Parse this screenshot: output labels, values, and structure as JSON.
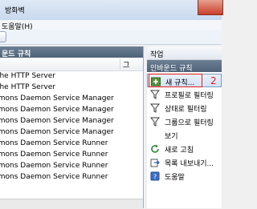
{
  "window": {
    "title": "방화벽"
  },
  "menu": {
    "items": [
      {
        "label": "도움말(H)"
      }
    ]
  },
  "left_pane": {
    "header": "운드 규칙",
    "column_header": "그",
    "rows": [
      "ache HTTP Server",
      "ache HTTP Server",
      "mmons Daemon Service Manager",
      "mmons Daemon Service Manager",
      "mmons Daemon Service Manager",
      "mmons Daemon Service Manager",
      "mmons Daemon Service Runner",
      "mmons Daemon Service Runner",
      "mmons Daemon Service Runner",
      "mmons Daemon Service Runner"
    ]
  },
  "right_pane": {
    "header": "작업",
    "section": "인바운드 규칙",
    "actions": [
      {
        "label": "새 규칙...",
        "icon": "new-rule-icon"
      },
      {
        "label": "프로필로 필터링",
        "icon": "filter-icon"
      },
      {
        "label": "상태로 필터링",
        "icon": "filter-icon"
      },
      {
        "label": "그룹으로 필터링",
        "icon": "filter-icon"
      },
      {
        "label": "보기",
        "icon": "view-icon"
      },
      {
        "label": "새로 고침",
        "icon": "refresh-icon"
      },
      {
        "label": "목록 내보내기...",
        "icon": "export-icon"
      },
      {
        "label": "도움말",
        "icon": "help-icon"
      }
    ]
  },
  "annotation": {
    "step": "2",
    "color": "#e01a1a"
  }
}
